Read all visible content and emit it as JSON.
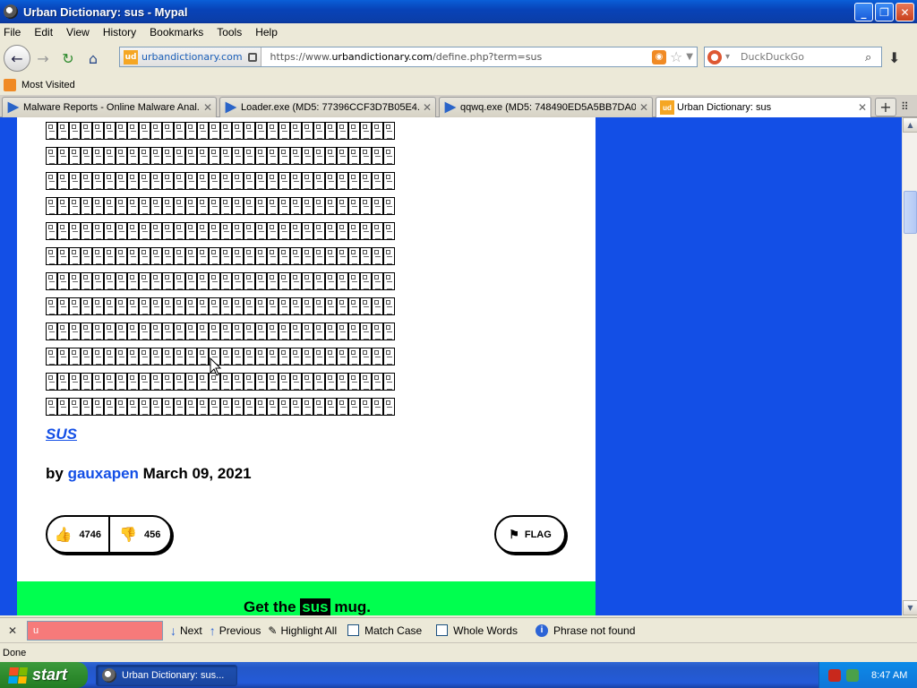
{
  "window": {
    "title": "Urban Dictionary: sus - Mypal"
  },
  "menu": {
    "items": [
      "File",
      "Edit",
      "View",
      "History",
      "Bookmarks",
      "Tools",
      "Help"
    ]
  },
  "navigation": {
    "site_domain": "urbandictionary.com",
    "site_favicon": "ud",
    "url_prefix": "https://www.",
    "url_host": "urbandictionary.com",
    "url_path": "/define.php?term=sus",
    "search_engine": "DuckDuckGo"
  },
  "bookmarks": {
    "most_visited": "Most Visited"
  },
  "tabs": [
    {
      "label": "Malware Reports - Online Malware Anal...",
      "icon": "virustotal-icon",
      "active": false
    },
    {
      "label": "Loader.exe (MD5: 77396CCF3D7B05E4...",
      "icon": "virustotal-icon",
      "active": false
    },
    {
      "label": "qqwq.exe (MD5: 748490ED5A5BB7DA0...",
      "icon": "virustotal-icon",
      "active": false
    },
    {
      "label": "Urban Dictionary: sus",
      "icon": "urban-dictionary-icon",
      "active": true
    }
  ],
  "definition": {
    "word": "SUS",
    "by": "by",
    "author": "gauxapen",
    "date": "March 09, 2021",
    "upvotes": "4746",
    "downvotes": "456",
    "flag": "FLAG"
  },
  "promo": {
    "prefix": "Get the",
    "highlight": "sus",
    "suffix": "mug."
  },
  "findbar": {
    "value": "u",
    "next": "Next",
    "previous": "Previous",
    "highlight_all": "Highlight All",
    "match_case": "Match Case",
    "whole_words": "Whole Words",
    "status": "Phrase not found"
  },
  "statusbar": {
    "text": "Done"
  },
  "taskbar": {
    "start": "start",
    "task": "Urban Dictionary: sus...",
    "clock": "8:47 AM"
  },
  "colors": {
    "ud_blue": "#134fe6",
    "promo_green": "#00ff4f",
    "find_not_found": "#f67a7a"
  }
}
